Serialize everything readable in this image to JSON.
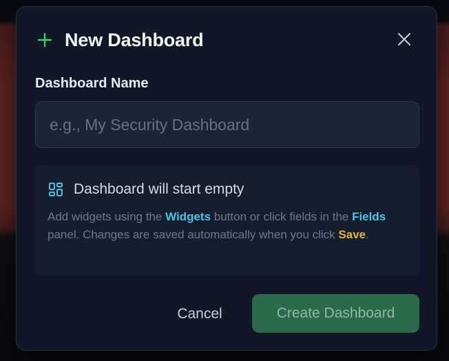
{
  "dialog": {
    "title": "New Dashboard",
    "icons": {
      "title_icon": "plus-icon",
      "close_icon": "close-icon",
      "info_icon": "layout-grid-icon"
    },
    "colors": {
      "accent_green": "#3ecf7a",
      "link_cyan": "#4cc4e2",
      "save_yellow": "#e0b33c",
      "create_button_bg": "#2a6a4a"
    }
  },
  "form": {
    "name_label": "Dashboard Name",
    "name_value": "",
    "name_placeholder": "e.g., My Security Dashboard"
  },
  "info": {
    "title": "Dashboard will start empty",
    "text_1": "Add widgets using the ",
    "link_widgets": "Widgets",
    "text_2": " button or click fields in the ",
    "link_fields": "Fields",
    "text_3": " panel. Changes are saved automatically when you click ",
    "link_save": "Save",
    "text_4": "."
  },
  "actions": {
    "cancel_label": "Cancel",
    "create_label": "Create Dashboard"
  }
}
